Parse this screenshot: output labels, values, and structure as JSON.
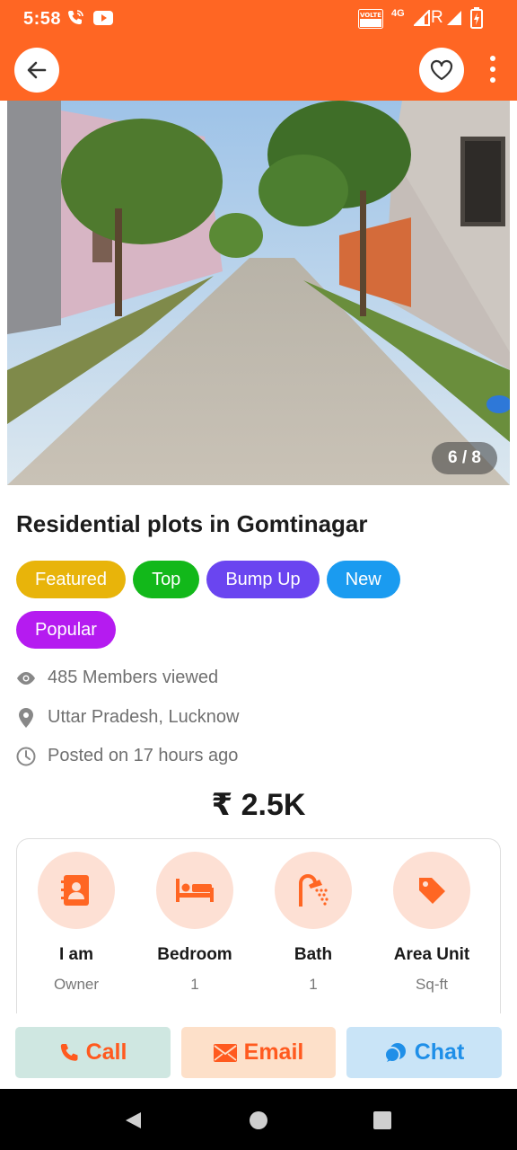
{
  "status_bar": {
    "time": "5:58",
    "network_label": "4G",
    "roaming_label": "R"
  },
  "colors": {
    "brand": "#ff6623",
    "featured": "#e8b40a",
    "top": "#12b81a",
    "bump_up": "#6a45f0",
    "new": "#1a9bf0",
    "popular": "#b51bf0"
  },
  "hero": {
    "counter": "6 / 8"
  },
  "listing": {
    "title": "Residential plots in Gomtinagar",
    "tags": [
      "Featured",
      "Top",
      "Bump Up",
      "New",
      "Popular"
    ],
    "views": "485 Members viewed",
    "location": "Uttar Pradesh, Lucknow",
    "posted": "Posted on 17 hours ago",
    "price": "₹ 2.5K"
  },
  "features": [
    {
      "label": "I am",
      "value": "Owner",
      "icon": "contact-book-icon"
    },
    {
      "label": "Bedroom",
      "value": "1",
      "icon": "bed-icon"
    },
    {
      "label": "Bath",
      "value": "1",
      "icon": "shower-icon"
    },
    {
      "label": "Area Unit",
      "value": "Sq-ft",
      "icon": "tag-icon"
    }
  ],
  "actions": {
    "call": "Call",
    "email": "Email",
    "chat": "Chat"
  }
}
